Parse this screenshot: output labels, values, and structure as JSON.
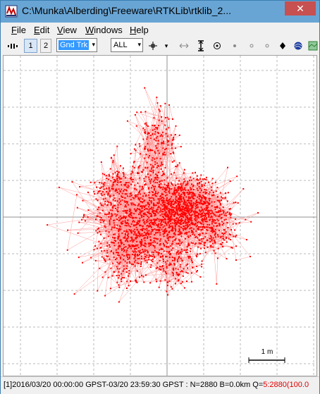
{
  "window": {
    "title": "C:\\Munka\\Alberding\\Freeware\\RTKLib\\rtklib_2...",
    "close_glyph": "✕"
  },
  "menu": [
    "File",
    "Edit",
    "View",
    "Windows",
    "Help"
  ],
  "toolbar": {
    "btn1_label": "1",
    "btn2_label": "2",
    "plot_type_value": "Gnd Trk",
    "sat_filter_value": "ALL",
    "arrow_glyph": "▾"
  },
  "plot": {
    "scale_label": "1 m",
    "point_color": "#ff0000",
    "line_color": "#ff9999",
    "grid_color": "#b8b8b8",
    "axis_color": "#909090"
  },
  "status": {
    "main": "[1]2016/03/20 00:00:00 GPST-03/20 23:59:30 GPST : N=2880 B=0.0km Q=",
    "quality": "5:2880(100.0"
  },
  "icons": [
    "app-icon",
    "solution-icon",
    "cursor-icon",
    "zoom-fit-icon",
    "fit-horizontal-icon",
    "fit-vertical-icon",
    "center-origin-icon",
    "mark-icon",
    "mark-icon-2",
    "mark-icon-3",
    "mark-filled-icon",
    "skyplot-icon",
    "map-icon"
  ]
}
